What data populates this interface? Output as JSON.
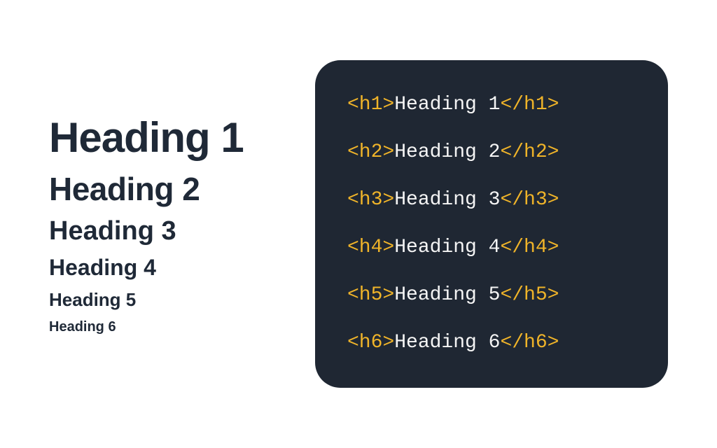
{
  "headings": {
    "h1": "Heading 1",
    "h2": "Heading 2",
    "h3": "Heading 3",
    "h4": "Heading 4",
    "h5": "Heading 5",
    "h6": "Heading 6"
  },
  "code": {
    "lines": [
      {
        "open": "<h1>",
        "text": "Heading 1",
        "close": "</h1>"
      },
      {
        "open": "<h2>",
        "text": "Heading 2",
        "close": "</h2>"
      },
      {
        "open": "<h3>",
        "text": "Heading 3",
        "close": "</h3>"
      },
      {
        "open": "<h4>",
        "text": "Heading 4",
        "close": "</h4>"
      },
      {
        "open": "<h5>",
        "text": "Heading 5",
        "close": "</h5>"
      },
      {
        "open": "<h6>",
        "text": "Heading 6",
        "close": "</h6>"
      }
    ]
  },
  "colors": {
    "code_bg": "#1f2733",
    "tag": "#f0b429",
    "text": "#f5f5f5",
    "heading": "#1f2937"
  }
}
